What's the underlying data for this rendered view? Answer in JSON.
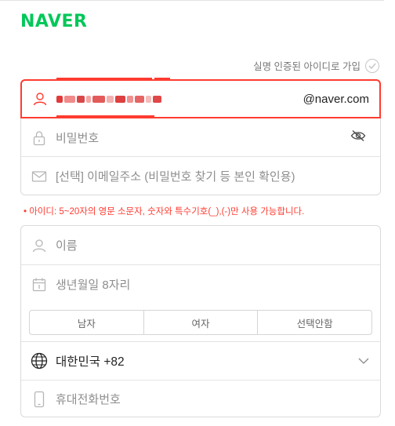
{
  "header": {
    "logo": "NAVER"
  },
  "verify": {
    "label": "실명 인증된 아이디로 가입"
  },
  "account": {
    "id_domain": "@naver.com",
    "password_placeholder": "비밀번호",
    "email_placeholder": "[선택] 이메일주소 (비밀번호 찾기 등 본인 확인용)"
  },
  "error": {
    "message": "• 아이디: 5~20자의 영문 소문자, 숫자와 특수기호(_),(-)만 사용 가능합니다."
  },
  "profile": {
    "name_placeholder": "이름",
    "birth_placeholder": "생년월일 8자리",
    "gender_options": [
      "남자",
      "여자",
      "선택안함"
    ],
    "country": "대한민국 +82",
    "phone_placeholder": "휴대전화번호"
  },
  "colors": {
    "brand": "#03c75a",
    "error": "#ff3b30",
    "border": "#dadada"
  },
  "icons": [
    "user-icon",
    "lock-icon",
    "eye-slash-icon",
    "mail-icon",
    "calendar-icon",
    "globe-icon",
    "chevron-down-icon",
    "phone-icon",
    "check-icon"
  ]
}
